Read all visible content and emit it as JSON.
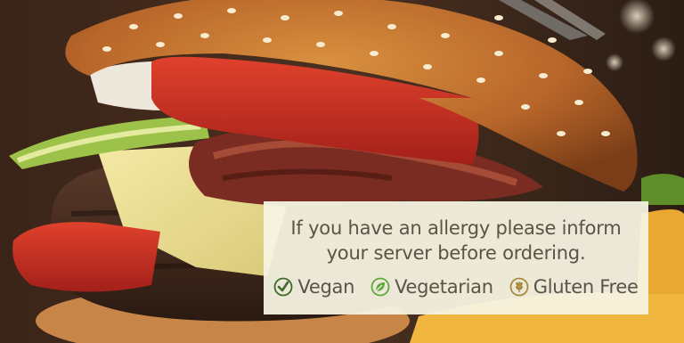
{
  "notice": {
    "message": "If you have an allergy please inform\nyour server before ordering.",
    "legend": [
      {
        "label": "Vegan",
        "icon": "vegan-check-icon",
        "color": "#3d6b2a"
      },
      {
        "label": "Vegetarian",
        "icon": "vegetarian-leaf-icon",
        "color": "#5fa83a"
      },
      {
        "label": "Gluten Free",
        "icon": "wheat-icon",
        "color": "#a88a3c"
      }
    ]
  }
}
